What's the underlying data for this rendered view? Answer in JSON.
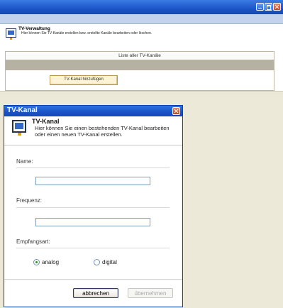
{
  "background_page": {
    "title": "TV-Verwaltung",
    "description": "Hier können Sie TV-Kanäle erstellen bzw. erstellte Kanäle bearbeiten oder löschen.",
    "list_header": "Liste aller TV-Kanäle",
    "add_button": "TV-Kanal hinzufügen"
  },
  "dialog": {
    "window_title": "TV-Kanal",
    "header_title": "TV-Kanal",
    "header_desc": "Hier können Sie einen bestehenden TV-Kanal bearbeiten oder einen neuen TV-Kanal erstellen.",
    "name_label": "Name:",
    "name_value": "",
    "frequency_label": "Frequenz:",
    "frequency_value": "",
    "reception_label": "Empfangsart:",
    "options": [
      {
        "label": "analog",
        "selected": true
      },
      {
        "label": "digital",
        "selected": false
      }
    ],
    "cancel_button": "abbrechen",
    "apply_button": "übernehmen"
  },
  "icons": [
    "tv-icon",
    "close-icon",
    "minimize-icon",
    "maximize-icon"
  ]
}
